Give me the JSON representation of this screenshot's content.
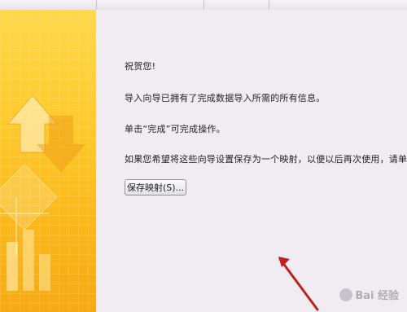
{
  "wizard": {
    "congrats": "祝贺您!",
    "info_line": "导入向导已拥有了完成数据导入所需的所有信息。",
    "finish_hint": "单击“完成”可完成操作。",
    "save_hint": "如果您希望将这些向导设置保存为一个映射，以便以后再次使用，请单击“保存",
    "save_button_label": "保存映射(S)..."
  },
  "watermark": {
    "text": "Bai 经验"
  },
  "colors": {
    "panel_top": "#ffd84a",
    "panel_bottom": "#f7a913",
    "content_bg": "#f1ecf2",
    "arrow": "#c0201c"
  },
  "icons": [
    "up-arrow-graphic",
    "down-arrow-graphic",
    "red-pointer-arrow-icon",
    "baidu-paw-icon"
  ]
}
